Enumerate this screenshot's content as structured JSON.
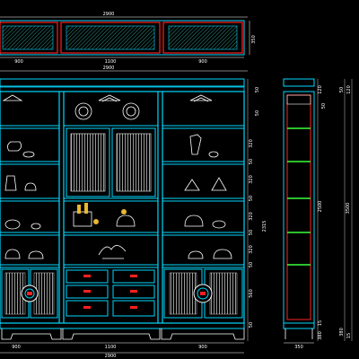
{
  "colors": {
    "background": "#000000",
    "frame": "#00d8ff",
    "accent": "#ff2020",
    "shelf": "#3cff3c",
    "dimension": "#ffffff",
    "ornament": "#ffffff",
    "hatch": "#3cbfa8"
  },
  "top_view": {
    "panel_widths": [
      "900",
      "1100",
      "900"
    ],
    "total_width": "2900",
    "height": "350"
  },
  "front_view": {
    "total_width_top": "2900",
    "total_width_bottom": "2900",
    "bay_widths": [
      "900",
      "1100",
      "900"
    ],
    "right_dims": [
      "50",
      "50",
      "320",
      "50",
      "320",
      "50",
      "320",
      "50",
      "320",
      "50",
      "560",
      "50"
    ],
    "overall_height": "2315"
  },
  "side_view": {
    "depth": "350",
    "top_dims": [
      "120",
      "50"
    ],
    "height": "2500",
    "bottom_dims": [
      "15",
      "380"
    ],
    "shelves": 6
  },
  "far_right": {
    "top_dims": [
      "50",
      "120"
    ],
    "height": "3500",
    "bottom_dims": [
      "380",
      "15"
    ]
  }
}
